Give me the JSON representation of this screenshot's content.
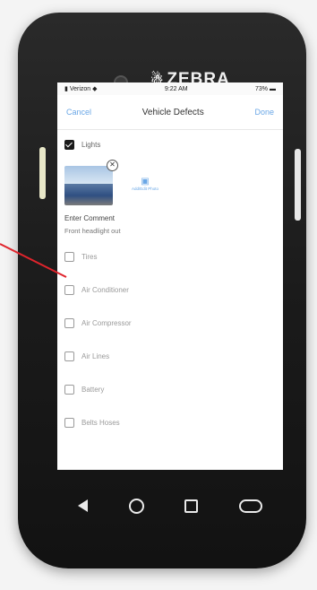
{
  "device": {
    "brand": "ZEBRA"
  },
  "status_bar": {
    "carrier": "Verizon",
    "time": "9:22 AM",
    "battery": "73%"
  },
  "nav": {
    "cancel": "Cancel",
    "title": "Vehicle Defects",
    "done": "Done"
  },
  "selected_item": {
    "label": "Lights",
    "checked": true
  },
  "photo": {
    "add_label": "Add/Edit Photo"
  },
  "comment": {
    "label": "Enter Comment",
    "value": "Front headlight out"
  },
  "items": [
    {
      "label": "Tires",
      "checked": false
    },
    {
      "label": "Air Conditioner",
      "checked": false
    },
    {
      "label": "Air Compressor",
      "checked": false
    },
    {
      "label": "Air Lines",
      "checked": false
    },
    {
      "label": "Battery",
      "checked": false
    },
    {
      "label": "Belts Hoses",
      "checked": false
    }
  ],
  "colors": {
    "accent": "#6aa7e6",
    "pointer": "#e0242c"
  },
  "icons": [
    "zebra-logo-icon",
    "wifi-icon",
    "battery-icon",
    "close-icon",
    "camera-icon",
    "back-icon",
    "home-icon",
    "recents-icon",
    "pill-icon"
  ]
}
